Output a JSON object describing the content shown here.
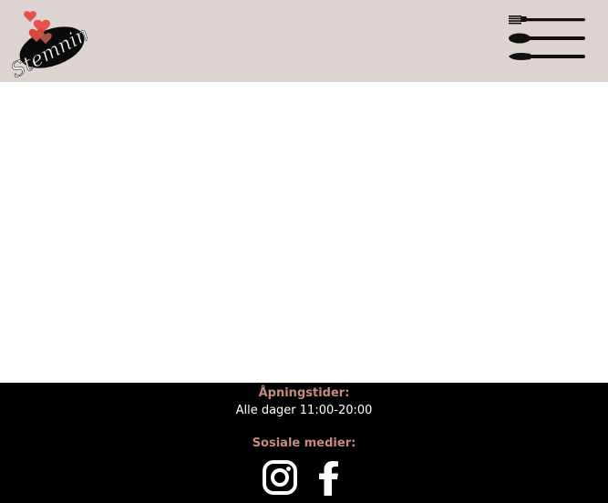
{
  "header": {
    "logo_text": "Stemning",
    "menu_icon": "cutlery-menu-icon"
  },
  "footer": {
    "hours_heading": "Åpningstider:",
    "hours_text": "Alle dager 11:00-20:00",
    "social_heading": "Sosiale medier:",
    "social_links": [
      {
        "icon": "instagram-icon"
      },
      {
        "icon": "facebook-icon"
      }
    ]
  },
  "colors": {
    "header_bg": "#ddd3d0",
    "footer_bg": "#000000",
    "accent": "#c58a80",
    "heart": "#e8524e"
  }
}
